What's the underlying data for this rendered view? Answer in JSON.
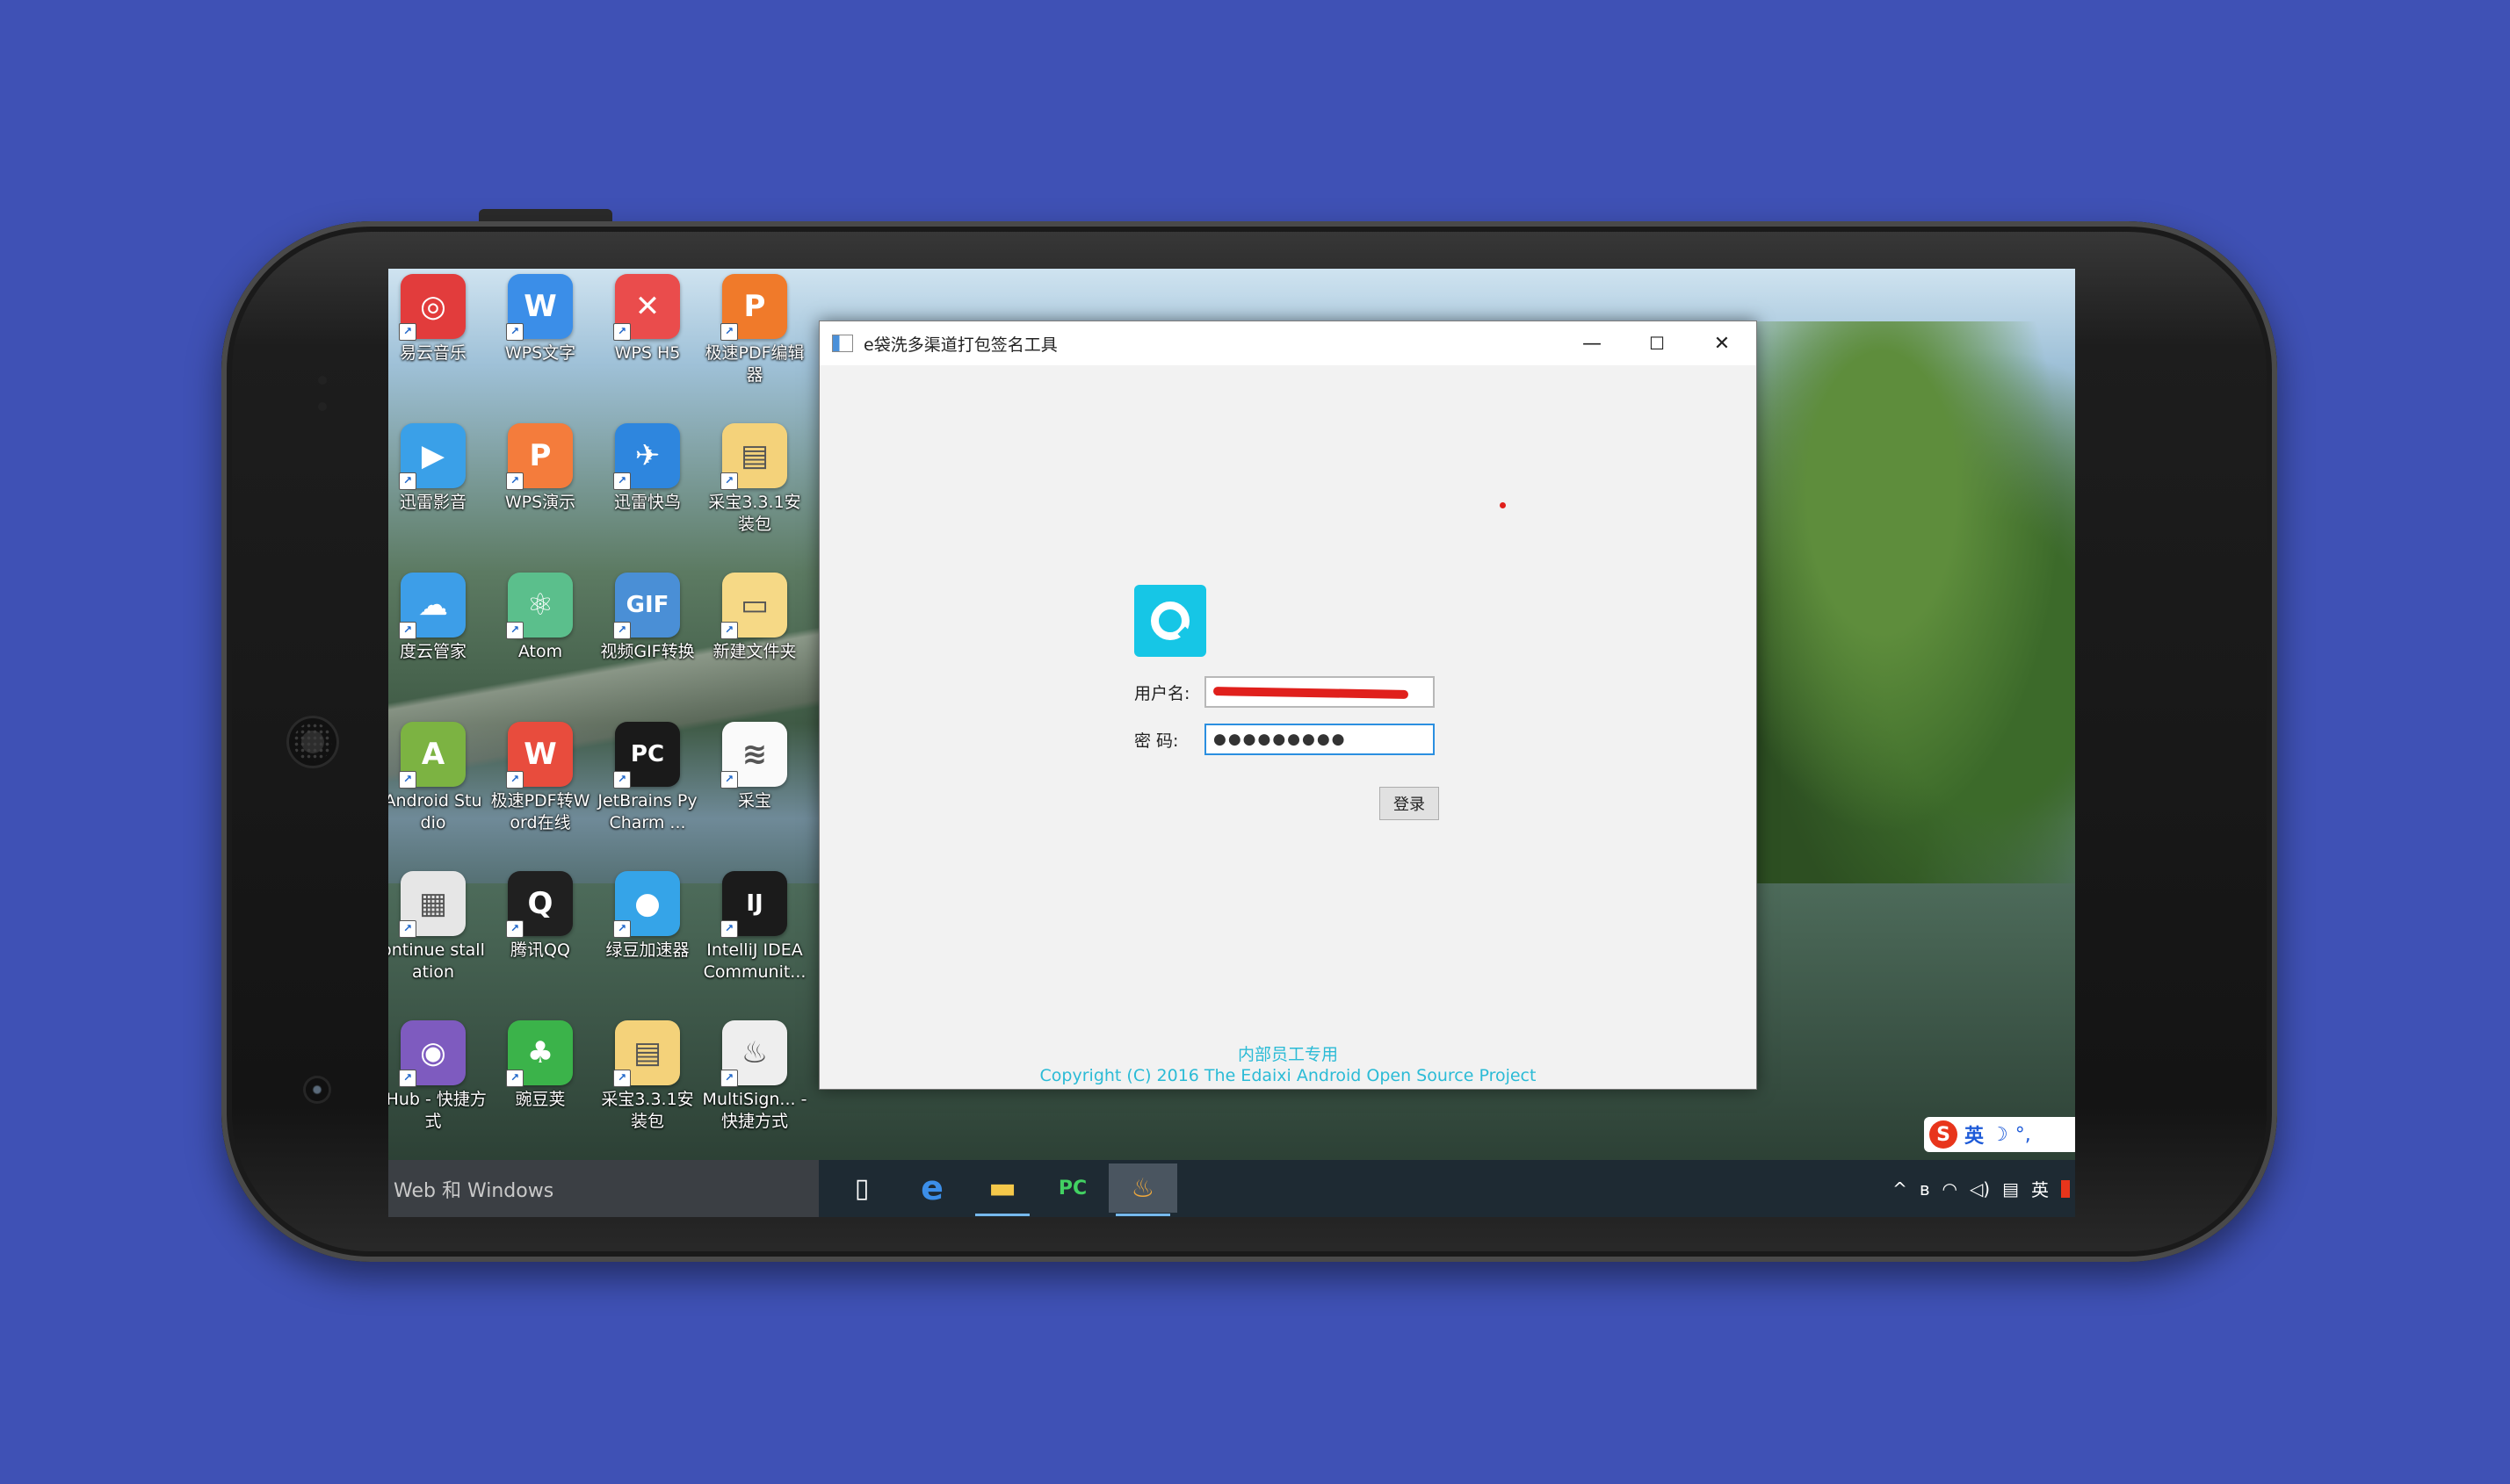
{
  "desktop": {
    "icons": [
      {
        "label": "易云音乐",
        "glyph": "◎",
        "color": "#e23c3c"
      },
      {
        "label": "WPS文字",
        "glyph": "W",
        "color": "#3b8ee8"
      },
      {
        "label": "WPS H5",
        "glyph": "✕",
        "color": "#ea4c4c"
      },
      {
        "label": "极速PDF编辑器",
        "glyph": "P",
        "color": "#f07a2a"
      },
      {
        "label": "迅雷影音",
        "glyph": "▶",
        "color": "#3aa0e8"
      },
      {
        "label": "WPS演示",
        "glyph": "P",
        "color": "#f47c3c"
      },
      {
        "label": "迅雷快鸟",
        "glyph": "✈",
        "color": "#2e86de"
      },
      {
        "label": "采宝3.3.1安装包",
        "glyph": "▤",
        "color": "#f4d27a"
      },
      {
        "label": "度云管家",
        "glyph": "☁",
        "color": "#3d9ee8"
      },
      {
        "label": "Atom",
        "glyph": "⚛",
        "color": "#5bbf8c"
      },
      {
        "label": "视频GIF转换",
        "glyph": "GIF",
        "color": "#4a8fd6"
      },
      {
        "label": "新建文件夹",
        "glyph": "▭",
        "color": "#f6d986"
      },
      {
        "label": "Android Studio",
        "glyph": "A",
        "color": "#7cb342"
      },
      {
        "label": "极速PDF转Word在线",
        "glyph": "W",
        "color": "#e84c3d"
      },
      {
        "label": "JetBrains PyCharm ...",
        "glyph": "PC",
        "color": "#1a1a1a"
      },
      {
        "label": "采宝",
        "glyph": "≋",
        "color": "#fafafa"
      },
      {
        "label": "ontinue stallation",
        "glyph": "▦",
        "color": "#e6e6e6"
      },
      {
        "label": "腾讯QQ",
        "glyph": "Q",
        "color": "#202020"
      },
      {
        "label": "绿豆加速器",
        "glyph": "●",
        "color": "#35a4e8"
      },
      {
        "label": "IntelliJ IDEA Communit...",
        "glyph": "IJ",
        "color": "#1b1b1b"
      },
      {
        "label": "tHub - 快捷方式",
        "glyph": "◉",
        "color": "#7e5bbf"
      },
      {
        "label": "豌豆荚",
        "glyph": "♣",
        "color": "#3bb34a"
      },
      {
        "label": "采宝3.3.1安装包",
        "glyph": "▤",
        "color": "#f4d27a"
      },
      {
        "label": "MultiSign... - 快捷方式",
        "glyph": "♨",
        "color": "#eeeeee"
      }
    ]
  },
  "window": {
    "title": "e袋洗多渠道打包签名工具",
    "minimize": "—",
    "maximize": "☐",
    "close": "✕",
    "username_label": "用户名:",
    "password_label": "密 码:",
    "password_value": "●●●●●●●●●",
    "login_button": "登录",
    "footer_line1": "内部员工专用",
    "footer_line2": "Copyright (C) 2016 The Edaixi Android Open Source Project"
  },
  "taskbar": {
    "search_text": "Web 和 Windows",
    "apps": [
      {
        "name": "task-view-icon",
        "glyph": "▯"
      },
      {
        "name": "edge-icon",
        "glyph": "e"
      },
      {
        "name": "file-explorer-icon",
        "glyph": "▬"
      },
      {
        "name": "pycharm-taskbar-icon",
        "glyph": "PC"
      },
      {
        "name": "java-app-icon",
        "glyph": "♨"
      }
    ],
    "tray": {
      "chevron": "^",
      "bluetooth": "ʙ",
      "wifi": "◠",
      "volume": "◁)",
      "notifications": "▤",
      "ime": "英"
    }
  },
  "ime_bar": {
    "logo": "S",
    "mode": "英",
    "moon": "☽",
    "punct": "°,",
    "mic": "🎤"
  },
  "colors": {
    "background": "#3f51b5",
    "accent": "#16c6e6",
    "footer_text": "#2bbbd6"
  }
}
